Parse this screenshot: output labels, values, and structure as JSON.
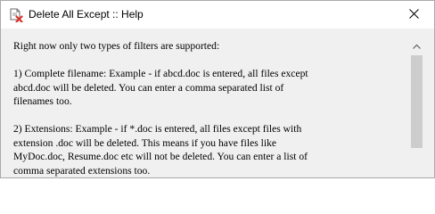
{
  "window": {
    "title": "Delete All Except :: Help",
    "app_icon": "delete-document-icon",
    "close_icon": "close-icon"
  },
  "help": {
    "lines": [
      "Right now only two types of filters are supported:",
      "",
      "1) Complete filename: Example - if abcd.doc is entered, all files except",
      "abcd.doc will be deleted. You can enter a comma separated list of",
      "filenames too.",
      "",
      "2) Extensions: Example - if *.doc is entered, all files except files with",
      "extension .doc will be deleted. This means if you have files like",
      "MyDoc.doc, Resume.doc etc will not be deleted. You can enter a list of",
      "comma separated extensions too."
    ]
  },
  "scrollbar": {
    "up_icon": "chevron-up-icon",
    "position": 0
  },
  "colors": {
    "title_bg": "#ffffff",
    "content_bg": "#f0f0f0",
    "thumb": "#cdcdcd",
    "icon_red": "#d9342b"
  }
}
